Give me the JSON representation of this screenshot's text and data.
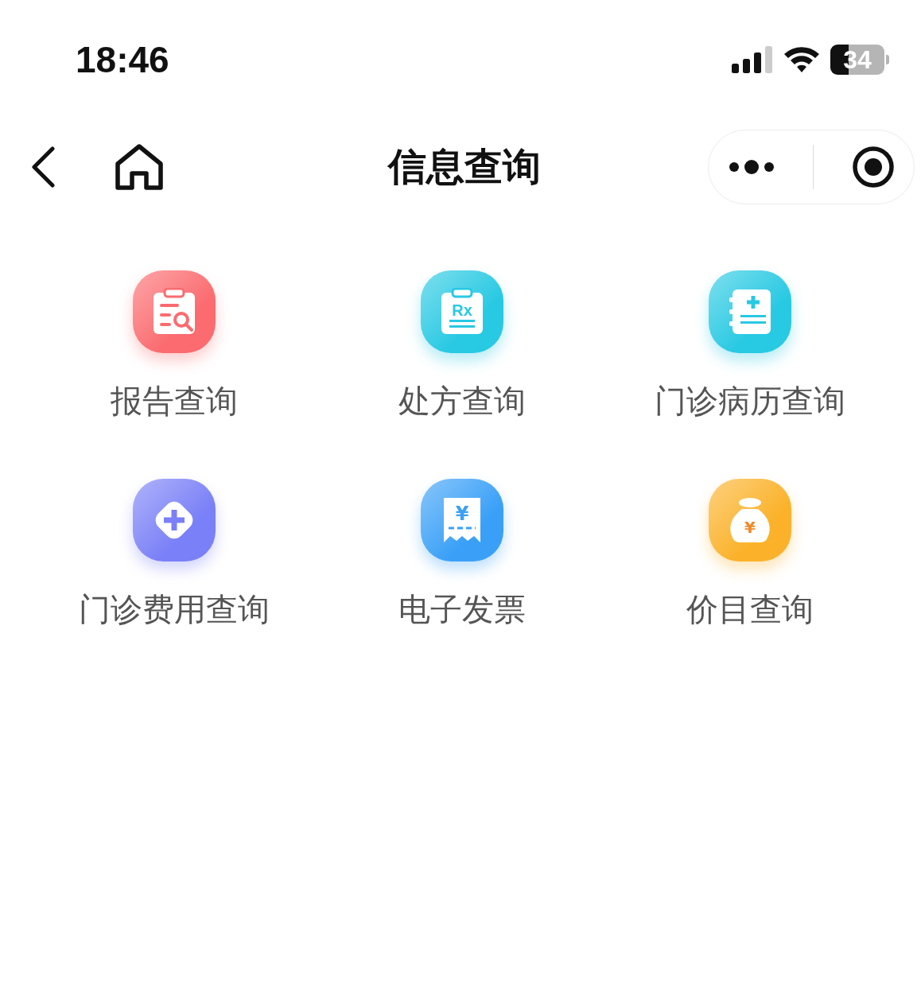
{
  "status_bar": {
    "time": "18:46",
    "battery": "34"
  },
  "nav_bar": {
    "title": "信息查询"
  },
  "items": [
    {
      "label": "报告查询",
      "kind": "report",
      "color": "#fb6b6f"
    },
    {
      "label": "处方查询",
      "kind": "prescription",
      "color": "#28c9e3",
      "mark": "Rx"
    },
    {
      "label": "门诊病历查询",
      "kind": "record",
      "color": "#28c9e3"
    },
    {
      "label": "门诊费用查询",
      "kind": "fee",
      "color": "#7a80f7"
    },
    {
      "label": "电子发票",
      "kind": "invoice",
      "color": "#3aa0f7",
      "mark": "¥"
    },
    {
      "label": "价目查询",
      "kind": "price",
      "color": "#fbb22a",
      "mark": "¥"
    }
  ]
}
